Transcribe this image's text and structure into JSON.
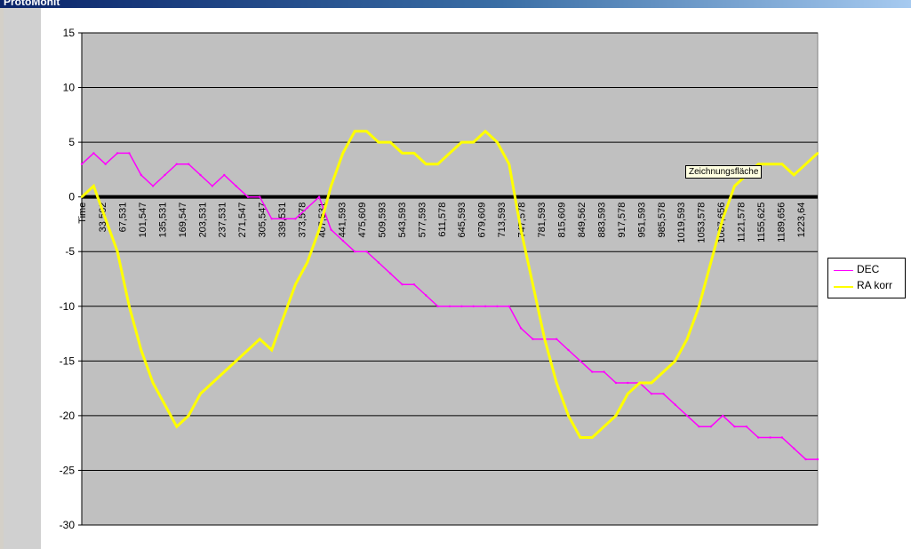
{
  "window": {
    "title": "ProtoMonit"
  },
  "tooltip": {
    "text": "Zeichnungsfläche"
  },
  "chart_data": {
    "type": "line",
    "title": "",
    "xlabel": "Time",
    "ylabel": "",
    "ylim": [
      -30,
      15
    ],
    "yticks": [
      15,
      10,
      5,
      0,
      -5,
      -10,
      -15,
      -20,
      -25,
      -30
    ],
    "grid": true,
    "legend_position": "right",
    "plot_background": "#c0c0c0",
    "x_tick_labels": [
      "33,562",
      "67,531",
      "101,547",
      "135,531",
      "169,547",
      "203,531",
      "237,531",
      "271,547",
      "305,547",
      "339,531",
      "373,578",
      "407,531",
      "441,593",
      "475,609",
      "509,593",
      "543,593",
      "577,593",
      "611,578",
      "645,593",
      "679,609",
      "713,593",
      "747,578",
      "781,593",
      "815,609",
      "849,562",
      "883,593",
      "917,578",
      "951,593",
      "985,578",
      "1019,593",
      "1053,578",
      "1087,656",
      "1121,578",
      "1155,625",
      "1189,656",
      "1223,64"
    ],
    "series": [
      {
        "name": "DEC",
        "color": "#ff00ff",
        "x": [
          0,
          20,
          40,
          60,
          80,
          100,
          120,
          140,
          160,
          180,
          200,
          220,
          240,
          260,
          280,
          300,
          320,
          340,
          360,
          380,
          400,
          420,
          440,
          460,
          480,
          500,
          520,
          540,
          560,
          580,
          600,
          620,
          640,
          660,
          680,
          700,
          720,
          740,
          760,
          780,
          800,
          820,
          840,
          860,
          880,
          900,
          920,
          940,
          960,
          980,
          1000,
          1020,
          1040,
          1060,
          1080,
          1100,
          1120,
          1140,
          1160,
          1180,
          1200,
          1220,
          1240
        ],
        "values": [
          3,
          4,
          3,
          4,
          4,
          2,
          1,
          2,
          3,
          3,
          2,
          1,
          2,
          1,
          0,
          0,
          -2,
          -2,
          -2,
          -1,
          0,
          -3,
          -4,
          -5,
          -5,
          -6,
          -7,
          -8,
          -8,
          -9,
          -10,
          -10,
          -10,
          -10,
          -10,
          -10,
          -10,
          -12,
          -13,
          -13,
          -13,
          -14,
          -15,
          -16,
          -16,
          -17,
          -17,
          -17,
          -18,
          -18,
          -19,
          -20,
          -21,
          -21,
          -20,
          -21,
          -21,
          -22,
          -22,
          -22,
          -23,
          -24,
          -24
        ]
      },
      {
        "name": "RA korr",
        "color": "#ffff00",
        "x": [
          0,
          20,
          40,
          60,
          80,
          100,
          120,
          140,
          160,
          180,
          200,
          220,
          240,
          260,
          280,
          300,
          320,
          340,
          360,
          380,
          400,
          420,
          440,
          460,
          480,
          500,
          520,
          540,
          560,
          580,
          600,
          620,
          640,
          660,
          680,
          700,
          720,
          740,
          760,
          780,
          800,
          820,
          840,
          860,
          880,
          900,
          920,
          940,
          960,
          980,
          1000,
          1020,
          1040,
          1060,
          1080,
          1100,
          1120,
          1140,
          1160,
          1180,
          1200,
          1220,
          1240
        ],
        "values": [
          0,
          1,
          -2,
          -5,
          -10,
          -14,
          -17,
          -19,
          -21,
          -20,
          -18,
          -17,
          -16,
          -15,
          -14,
          -13,
          -14,
          -11,
          -8,
          -6,
          -3,
          1,
          4,
          6,
          6,
          5,
          5,
          4,
          4,
          3,
          3,
          4,
          5,
          5,
          6,
          5,
          3,
          -3,
          -8,
          -13,
          -17,
          -20,
          -22,
          -22,
          -21,
          -20,
          -18,
          -17,
          -17,
          -16,
          -15,
          -13,
          -10,
          -6,
          -2,
          1,
          2,
          3,
          3,
          3,
          2,
          3,
          4
        ]
      }
    ]
  }
}
